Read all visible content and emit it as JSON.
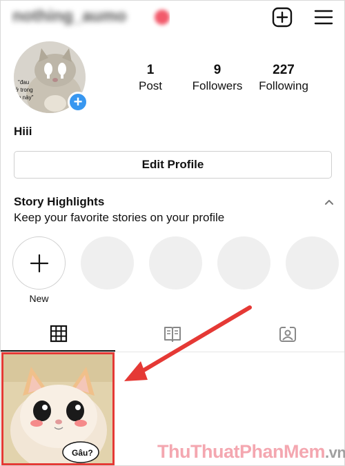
{
  "header": {
    "username": "nothing_aumo",
    "new_post_icon": "plus-square-icon",
    "menu_icon": "hamburger-menu-icon"
  },
  "profile": {
    "avatar_caption": "\"đau\nở trong\nim này\"",
    "stats": {
      "posts": {
        "value": "1",
        "label": "Post"
      },
      "followers": {
        "value": "9",
        "label": "Followers"
      },
      "following": {
        "value": "227",
        "label": "Following"
      }
    },
    "bio": "Hiii",
    "edit_button_label": "Edit Profile"
  },
  "highlights": {
    "title": "Story Highlights",
    "subtitle": "Keep your favorite stories on your profile",
    "new_label": "New",
    "placeholder_count": 4
  },
  "tabs": [
    {
      "name": "grid",
      "icon": "grid-icon",
      "active": true
    },
    {
      "name": "guides",
      "icon": "guides-book-icon",
      "active": false
    },
    {
      "name": "tagged",
      "icon": "tagged-person-icon",
      "active": false
    }
  ],
  "posts": [
    {
      "speech_bubble": "Gâu?"
    }
  ],
  "watermark": {
    "part1": "ThuThuat",
    "part2": "PhanMem",
    "part3": ".vn"
  },
  "colors": {
    "accent_blue": "#3897f0",
    "highlight_red": "#e53935",
    "arrow_red": "#e53935"
  }
}
